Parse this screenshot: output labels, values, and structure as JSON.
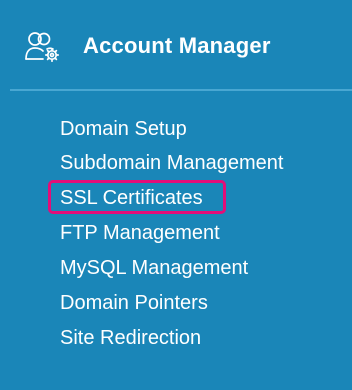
{
  "header": {
    "icon": "users-gear-icon",
    "title": "Account Manager"
  },
  "menu": {
    "items": [
      {
        "label": "Domain Setup"
      },
      {
        "label": "Subdomain Management"
      },
      {
        "label": "SSL Certificates",
        "highlighted": true
      },
      {
        "label": "FTP Management"
      },
      {
        "label": "MySQL Management"
      },
      {
        "label": "Domain Pointers"
      },
      {
        "label": "Site Redirection"
      }
    ]
  },
  "colors": {
    "background": "#1a86b8",
    "divider": "#49a7d2",
    "text": "#ffffff",
    "highlight_border": "#e40d78"
  }
}
